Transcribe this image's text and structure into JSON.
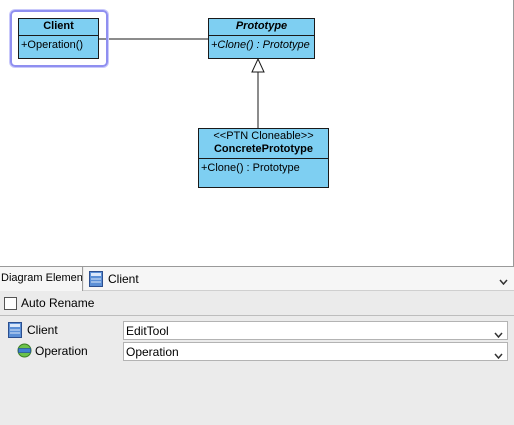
{
  "diagram": {
    "classes": {
      "client": {
        "name": "Client",
        "operations": [
          "+Operation()"
        ]
      },
      "prototype": {
        "name": "Prototype",
        "operations": [
          "+Clone() : Prototype"
        ]
      },
      "concrete_prototype": {
        "stereotype": "<<PTN Cloneable>>",
        "name": "ConcretePrototype",
        "operations": [
          "+Clone() : Prototype"
        ]
      }
    },
    "selected": "Client",
    "colors": {
      "class_fill": "#7ecff2",
      "selection": "#8f8ff0"
    }
  },
  "panel": {
    "tab_label": "Diagram Element",
    "element_combo": {
      "icon": "class-icon",
      "value": "Client"
    },
    "auto_rename": {
      "label": "Auto Rename",
      "checked": false
    },
    "properties": [
      {
        "icon": "class-icon",
        "label": "Client",
        "value": "EditTool"
      },
      {
        "icon": "operation-icon",
        "label": "Operation",
        "value": "Operation"
      }
    ]
  }
}
